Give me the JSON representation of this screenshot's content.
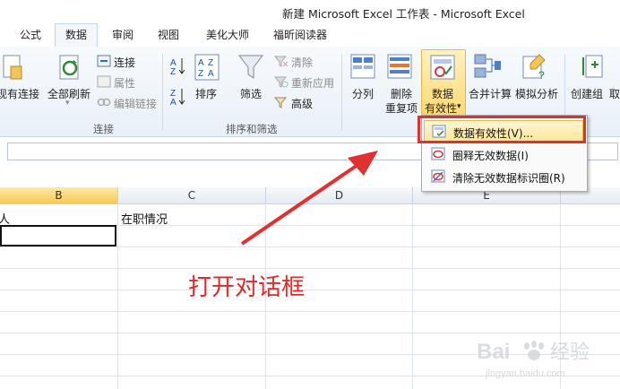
{
  "window": {
    "title": "新建 Microsoft Excel 工作表 - Microsoft Excel"
  },
  "tabs": [
    {
      "label": "公式"
    },
    {
      "label": "数据",
      "active": true
    },
    {
      "label": "审阅"
    },
    {
      "label": "视图"
    },
    {
      "label": "美化大师"
    },
    {
      "label": "福昕阅读器"
    }
  ],
  "ribbon": {
    "existing_conn": "现有连接",
    "refresh_all": "全部刷新",
    "connections": "连接",
    "properties": "属性",
    "edit_links": "编辑链接",
    "group_connections": "连接",
    "sort_asc_label": "A↓Z",
    "sort": "排序",
    "filter": "筛选",
    "clear": "清除",
    "reapply": "重新应用",
    "advanced": "高级",
    "group_sort_filter": "排序和筛选",
    "split": "分列",
    "remove_dup_1": "删除",
    "remove_dup_2": "重复项",
    "data_validation_1": "数据",
    "data_validation_2": "有效性",
    "consolidate": "合并计算",
    "what_if": "模拟分析",
    "group_create": "创建组",
    "ungroup_partial": "取"
  },
  "dropdown": {
    "items": [
      {
        "label": "数据有效性(V)...",
        "highlighted": true
      },
      {
        "label": "圈释无效数据(I)"
      },
      {
        "label": "清除无效数据标识圈(R)"
      }
    ]
  },
  "sheet": {
    "columns": [
      "B",
      "C",
      "D",
      "E"
    ],
    "cells": {
      "b1": "人",
      "c1": "在职情况"
    }
  },
  "annotation": {
    "text": "打开对话框"
  },
  "watermark": {
    "brand": "Baidu",
    "sub": "经验",
    "url": "jingyan.baidu.com"
  },
  "colors": {
    "accent_red": "#e03030",
    "highlight": "#ffd870",
    "tab_border": "#c5d5ea"
  }
}
